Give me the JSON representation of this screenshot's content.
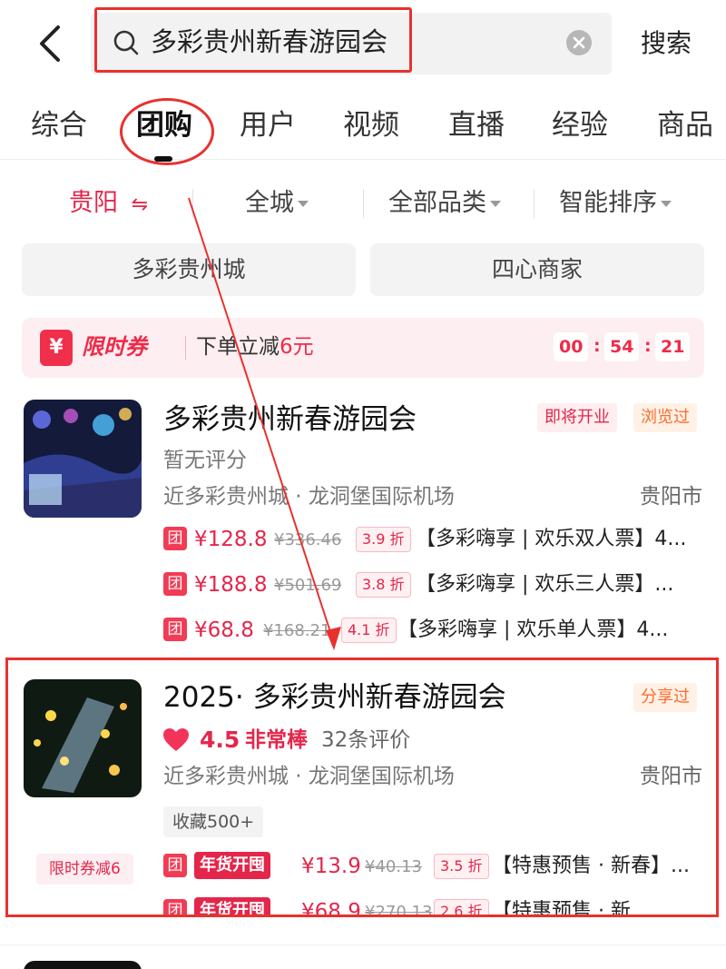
{
  "header": {
    "query": "多彩贵州新春游园会",
    "search_button": "搜索"
  },
  "tabs": [
    "综合",
    "团购",
    "用户",
    "视频",
    "直播",
    "经验",
    "商品"
  ],
  "active_tab": "团购",
  "filters": {
    "city": "贵阳",
    "city_switch_glyph": "⇋",
    "area": "全城",
    "category": "全部品类",
    "sort": "智能排序"
  },
  "chips": [
    "多彩贵州城",
    "四心商家"
  ],
  "coupon_banner": {
    "logo": "¥",
    "title": "限时券",
    "text_prefix": "下单立减",
    "amount": "6元",
    "timer": [
      "00",
      "54",
      "21"
    ]
  },
  "results": [
    {
      "title": "多彩贵州新春游园会",
      "tags": [
        "即将开业",
        "浏览过"
      ],
      "rating_text": "暂无评分",
      "location": "近多彩贵州城 · 龙洞堡国际机场",
      "city": "贵阳市",
      "deals": [
        {
          "badge": "团",
          "price": "¥128.8",
          "original": "¥336.46",
          "discount": "3.9 折",
          "name": "【多彩嗨享 | 欢乐双人票】4..."
        },
        {
          "badge": "团",
          "price": "¥188.8",
          "original": "¥501.69",
          "discount": "3.8 折",
          "name": "【多彩嗨享 | 欢乐三人票】..."
        },
        {
          "badge": "团",
          "price": "¥68.8",
          "original": "¥168.21",
          "discount": "4.1 折",
          "name": "【多彩嗨享 | 欢乐单人票】4..."
        }
      ]
    },
    {
      "title": "2025· 多彩贵州新春游园会",
      "tags": [
        "分享过"
      ],
      "rating": {
        "score": "4.5",
        "label": "非常棒",
        "count": "32条评价"
      },
      "location": "近多彩贵州城 · 龙洞堡国际机场",
      "city": "贵阳市",
      "favorites": "收藏500+",
      "coupon_chip": "限时券减6",
      "deals": [
        {
          "badge": "团",
          "promo": "年货开囤",
          "price": "¥13.9",
          "original": "¥40.13",
          "discount": "3.5 折",
          "name": "【特惠预售 · 新春】..."
        },
        {
          "badge": "团",
          "promo": "年货开囤",
          "price": "¥68.9",
          "original": "¥270.13",
          "discount": "2.6 折",
          "name": "【特惠预售 · 新"
        }
      ]
    }
  ],
  "colors": {
    "accent": "#e4264b",
    "annotation": "#e8312f",
    "tag_orange": "#ff6a2c"
  }
}
